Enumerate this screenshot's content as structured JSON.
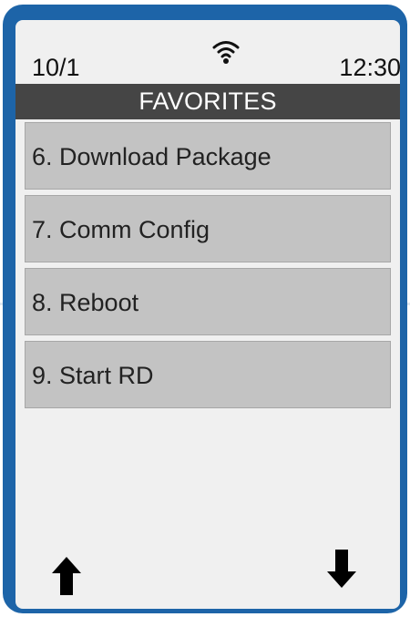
{
  "status": {
    "date": "10/1",
    "time": "12:30",
    "wifi_icon": "wifi-icon"
  },
  "screen": {
    "title": "FAVORITES",
    "menu_items": [
      {
        "label": "6. Download Package"
      },
      {
        "label": "7. Comm Config"
      },
      {
        "label": "8. Reboot"
      },
      {
        "label": "9. Start RD"
      }
    ]
  },
  "navigation": {
    "up_icon": "arrow-up-icon",
    "down_icon": "arrow-down-icon"
  },
  "colors": {
    "device_frame": "#1d64a8",
    "screen_background": "#f0f0f0",
    "title_bar": "#454545",
    "menu_item": "#c3c3c3"
  }
}
